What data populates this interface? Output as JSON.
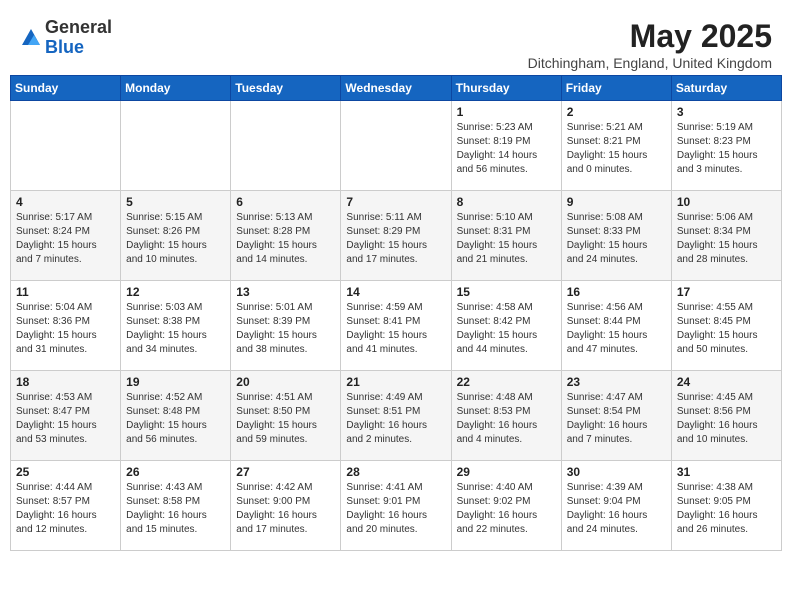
{
  "header": {
    "logo_general": "General",
    "logo_blue": "Blue",
    "title": "May 2025",
    "location": "Ditchingham, England, United Kingdom"
  },
  "weekdays": [
    "Sunday",
    "Monday",
    "Tuesday",
    "Wednesday",
    "Thursday",
    "Friday",
    "Saturday"
  ],
  "weeks": [
    [
      {
        "day": "",
        "info": ""
      },
      {
        "day": "",
        "info": ""
      },
      {
        "day": "",
        "info": ""
      },
      {
        "day": "",
        "info": ""
      },
      {
        "day": "1",
        "info": "Sunrise: 5:23 AM\nSunset: 8:19 PM\nDaylight: 14 hours\nand 56 minutes."
      },
      {
        "day": "2",
        "info": "Sunrise: 5:21 AM\nSunset: 8:21 PM\nDaylight: 15 hours\nand 0 minutes."
      },
      {
        "day": "3",
        "info": "Sunrise: 5:19 AM\nSunset: 8:23 PM\nDaylight: 15 hours\nand 3 minutes."
      }
    ],
    [
      {
        "day": "4",
        "info": "Sunrise: 5:17 AM\nSunset: 8:24 PM\nDaylight: 15 hours\nand 7 minutes."
      },
      {
        "day": "5",
        "info": "Sunrise: 5:15 AM\nSunset: 8:26 PM\nDaylight: 15 hours\nand 10 minutes."
      },
      {
        "day": "6",
        "info": "Sunrise: 5:13 AM\nSunset: 8:28 PM\nDaylight: 15 hours\nand 14 minutes."
      },
      {
        "day": "7",
        "info": "Sunrise: 5:11 AM\nSunset: 8:29 PM\nDaylight: 15 hours\nand 17 minutes."
      },
      {
        "day": "8",
        "info": "Sunrise: 5:10 AM\nSunset: 8:31 PM\nDaylight: 15 hours\nand 21 minutes."
      },
      {
        "day": "9",
        "info": "Sunrise: 5:08 AM\nSunset: 8:33 PM\nDaylight: 15 hours\nand 24 minutes."
      },
      {
        "day": "10",
        "info": "Sunrise: 5:06 AM\nSunset: 8:34 PM\nDaylight: 15 hours\nand 28 minutes."
      }
    ],
    [
      {
        "day": "11",
        "info": "Sunrise: 5:04 AM\nSunset: 8:36 PM\nDaylight: 15 hours\nand 31 minutes."
      },
      {
        "day": "12",
        "info": "Sunrise: 5:03 AM\nSunset: 8:38 PM\nDaylight: 15 hours\nand 34 minutes."
      },
      {
        "day": "13",
        "info": "Sunrise: 5:01 AM\nSunset: 8:39 PM\nDaylight: 15 hours\nand 38 minutes."
      },
      {
        "day": "14",
        "info": "Sunrise: 4:59 AM\nSunset: 8:41 PM\nDaylight: 15 hours\nand 41 minutes."
      },
      {
        "day": "15",
        "info": "Sunrise: 4:58 AM\nSunset: 8:42 PM\nDaylight: 15 hours\nand 44 minutes."
      },
      {
        "day": "16",
        "info": "Sunrise: 4:56 AM\nSunset: 8:44 PM\nDaylight: 15 hours\nand 47 minutes."
      },
      {
        "day": "17",
        "info": "Sunrise: 4:55 AM\nSunset: 8:45 PM\nDaylight: 15 hours\nand 50 minutes."
      }
    ],
    [
      {
        "day": "18",
        "info": "Sunrise: 4:53 AM\nSunset: 8:47 PM\nDaylight: 15 hours\nand 53 minutes."
      },
      {
        "day": "19",
        "info": "Sunrise: 4:52 AM\nSunset: 8:48 PM\nDaylight: 15 hours\nand 56 minutes."
      },
      {
        "day": "20",
        "info": "Sunrise: 4:51 AM\nSunset: 8:50 PM\nDaylight: 15 hours\nand 59 minutes."
      },
      {
        "day": "21",
        "info": "Sunrise: 4:49 AM\nSunset: 8:51 PM\nDaylight: 16 hours\nand 2 minutes."
      },
      {
        "day": "22",
        "info": "Sunrise: 4:48 AM\nSunset: 8:53 PM\nDaylight: 16 hours\nand 4 minutes."
      },
      {
        "day": "23",
        "info": "Sunrise: 4:47 AM\nSunset: 8:54 PM\nDaylight: 16 hours\nand 7 minutes."
      },
      {
        "day": "24",
        "info": "Sunrise: 4:45 AM\nSunset: 8:56 PM\nDaylight: 16 hours\nand 10 minutes."
      }
    ],
    [
      {
        "day": "25",
        "info": "Sunrise: 4:44 AM\nSunset: 8:57 PM\nDaylight: 16 hours\nand 12 minutes."
      },
      {
        "day": "26",
        "info": "Sunrise: 4:43 AM\nSunset: 8:58 PM\nDaylight: 16 hours\nand 15 minutes."
      },
      {
        "day": "27",
        "info": "Sunrise: 4:42 AM\nSunset: 9:00 PM\nDaylight: 16 hours\nand 17 minutes."
      },
      {
        "day": "28",
        "info": "Sunrise: 4:41 AM\nSunset: 9:01 PM\nDaylight: 16 hours\nand 20 minutes."
      },
      {
        "day": "29",
        "info": "Sunrise: 4:40 AM\nSunset: 9:02 PM\nDaylight: 16 hours\nand 22 minutes."
      },
      {
        "day": "30",
        "info": "Sunrise: 4:39 AM\nSunset: 9:04 PM\nDaylight: 16 hours\nand 24 minutes."
      },
      {
        "day": "31",
        "info": "Sunrise: 4:38 AM\nSunset: 9:05 PM\nDaylight: 16 hours\nand 26 minutes."
      }
    ]
  ]
}
